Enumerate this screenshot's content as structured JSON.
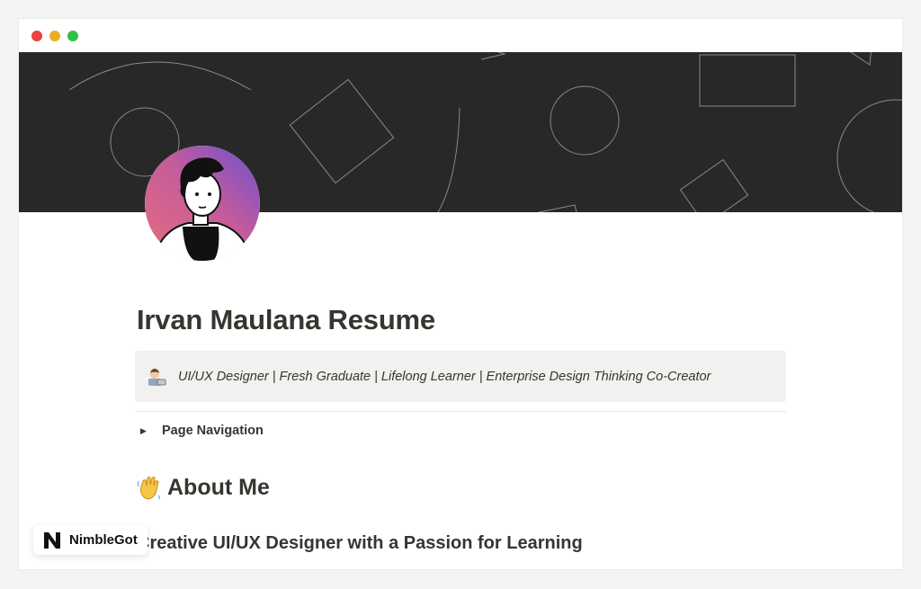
{
  "window": {
    "controls": [
      "close",
      "minimize",
      "maximize"
    ]
  },
  "cover": {
    "background": "#282828",
    "pattern": "outline-geometric-shapes"
  },
  "avatar": {
    "description_icon": "avatar-illustration-icon"
  },
  "page": {
    "title": "Irvan Maulana Resume",
    "callout": {
      "icon": "technologist-emoji-icon",
      "text": "UI/UX Designer | Fresh Graduate | Lifelong Learner | Enterprise Design Thinking Co-Creator"
    },
    "toggle": {
      "icon": "triangle-right-icon",
      "label": "Page Navigation"
    },
    "about": {
      "icon": "waving-hand-icon",
      "heading": "About Me",
      "subheading": "Creative UI/UX Designer with a Passion for Learning"
    }
  },
  "watermark": {
    "icon": "nimblegot-logo-icon",
    "label": "NimbleGot"
  },
  "colors": {
    "text": "#37352f",
    "callout_bg": "#f1f1ef",
    "cover_bg": "#282828",
    "close": "#ec4141",
    "minimize": "#e8b020",
    "maximize": "#2fc24a"
  }
}
